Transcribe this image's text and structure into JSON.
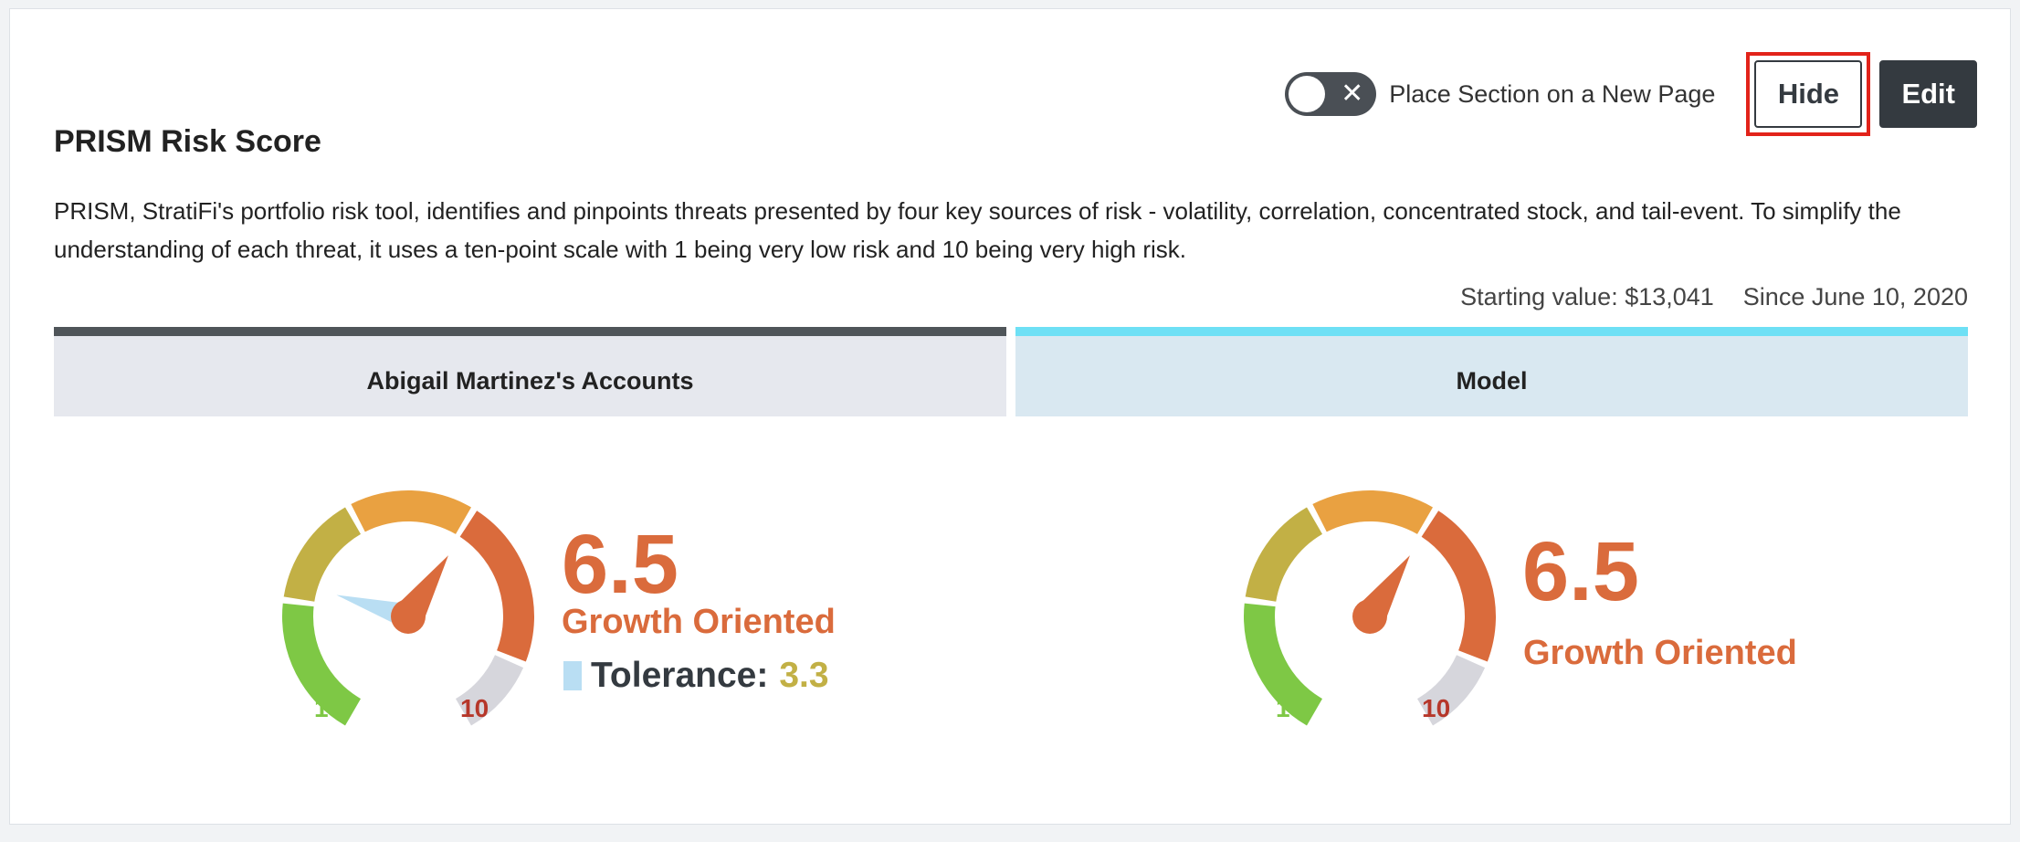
{
  "toolbar": {
    "toggle_label": "Place Section on a New Page",
    "toggle_state": "off",
    "hide_label": "Hide",
    "edit_label": "Edit"
  },
  "section": {
    "title": "PRISM Risk Score",
    "description": "PRISM, StratiFi's portfolio risk tool, identifies and pinpoints threats presented by four key sources of risk - volatility, correlation, concentrated stock, and tail-event. To simplify the understanding of each threat, it uses a ten-point scale with 1 being very low risk and 10 being very high risk.",
    "starting_value": "Starting value: $13,041",
    "since": "Since June 10, 2020"
  },
  "tabs": [
    {
      "label": "Abigail Martinez's Accounts",
      "accent": "#4f5559"
    },
    {
      "label": "Model",
      "accent": "#6ee0f5"
    }
  ],
  "gauges": [
    {
      "score": "6.5",
      "score_value": 6.5,
      "risk_label": "Growth Oriented",
      "tolerance_label": "Tolerance:",
      "tolerance_value": "3.3",
      "tolerance_number": 3.3,
      "min_label": "1",
      "max_label": "10"
    },
    {
      "score": "6.5",
      "score_value": 6.5,
      "risk_label": "Growth Oriented",
      "min_label": "1",
      "max_label": "10"
    }
  ],
  "colors": {
    "score": "#da6b3c",
    "tolerance_needle": "#b9def3",
    "segments": [
      "#7ec845",
      "#c2b045",
      "#e9a141",
      "#da6b3c",
      "#d6d6dc"
    ]
  }
}
